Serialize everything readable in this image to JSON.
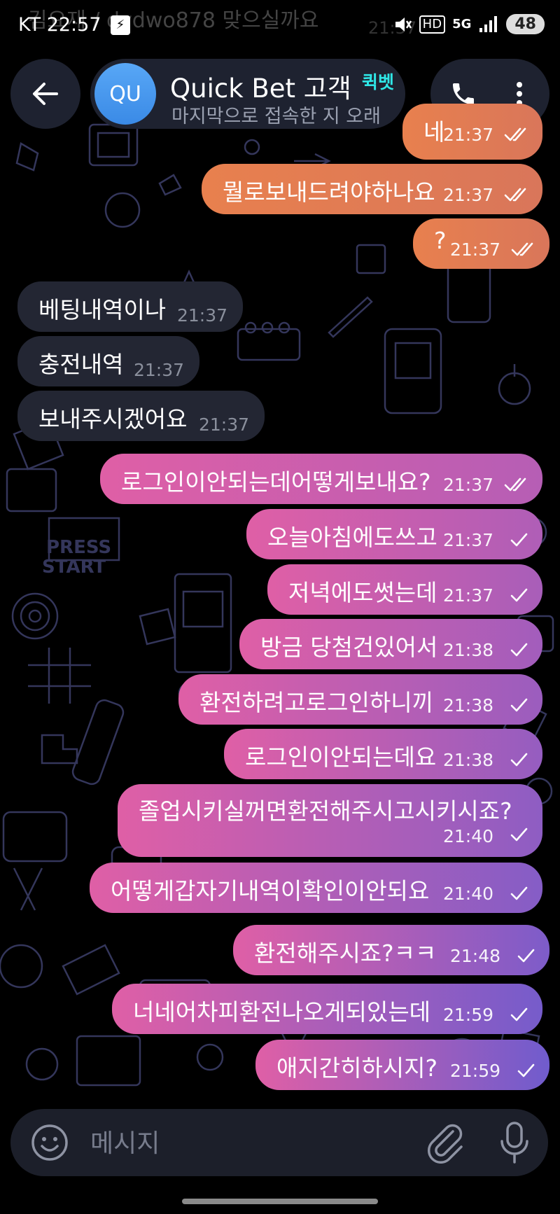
{
  "status_bar": {
    "carrier": "KT",
    "time": "22:57",
    "network": "5G",
    "hd_label": "HD",
    "battery": "48"
  },
  "ghost_notification": {
    "text": "김요재 / dydwo878 맞으실까요",
    "time": "21:37"
  },
  "header": {
    "avatar_initials": "QU",
    "title": "Quick Bet 고객",
    "badge": "퀵벳",
    "subtitle": "마지막으로 접속한 지 오래"
  },
  "messages": [
    {
      "dir": "out",
      "text": "네",
      "time": "21:37",
      "read": true
    },
    {
      "dir": "out",
      "text": "뭘로보내드려야하나요",
      "time": "21:37",
      "read": true
    },
    {
      "dir": "out",
      "text": "?",
      "time": "21:37",
      "read": true
    },
    {
      "dir": "in",
      "text": "베팅내역이나",
      "time": "21:37"
    },
    {
      "dir": "in",
      "text": "충전내역",
      "time": "21:37"
    },
    {
      "dir": "in",
      "text": "보내주시겠어요",
      "time": "21:37"
    },
    {
      "dir": "out",
      "text": "로그인이안되는데어떻게보내요?",
      "time": "21:37",
      "read": true
    },
    {
      "dir": "out",
      "text": "오늘아침에도쓰고",
      "time": "21:37",
      "read": false
    },
    {
      "dir": "out",
      "text": "저녁에도썻는데",
      "time": "21:37",
      "read": false
    },
    {
      "dir": "out",
      "text": "방금 당첨건있어서",
      "time": "21:38",
      "read": false
    },
    {
      "dir": "out",
      "text": "환전하려고로그인하니끼",
      "time": "21:38",
      "read": false
    },
    {
      "dir": "out",
      "text": "로그인이안되는데요",
      "time": "21:38",
      "read": false
    },
    {
      "dir": "out",
      "text": "졸업시키실꺼면환전해주시고시키시죠?",
      "time": "21:40",
      "read": false
    },
    {
      "dir": "out",
      "text": "어떻게갑자기내역이확인이안되요",
      "time": "21:40",
      "read": false
    },
    {
      "dir": "out",
      "text": "환전해주시죠?ㅋㅋ",
      "time": "21:48",
      "read": false
    },
    {
      "dir": "out",
      "text": "너네어차피환전나오게되있는데",
      "time": "21:59",
      "read": false
    },
    {
      "dir": "out",
      "text": "애지간히하시지?",
      "time": "21:59",
      "read": false
    }
  ],
  "composer": {
    "placeholder": "메시지"
  },
  "colors": {
    "background": "#000000",
    "incoming_bubble": "#232633",
    "header_bg": "#1e2230",
    "avatar": "#4a9af0",
    "badge": "#2fe6e6",
    "gradient_orange": "#e8804e",
    "gradient_pink": "#df5fa6",
    "gradient_purple": "#6b5ccf"
  }
}
